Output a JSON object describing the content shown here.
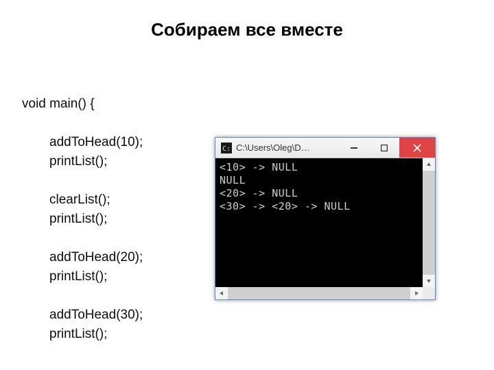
{
  "title": "Собираем все вместе",
  "code": {
    "l0": "void main() {",
    "l1": "addToHead(10);",
    "l2": "printList();",
    "l3": "clearList();",
    "l4": "printList();",
    "l5": "addToHead(20);",
    "l6": "printList();",
    "l7": "addToHead(30);",
    "l8": "printList();"
  },
  "console": {
    "window_title": "C:\\Users\\Oleg\\D…",
    "lines": [
      "<10> -> NULL",
      "NULL",
      "<20> -> NULL",
      "<30> -> <20> -> NULL"
    ]
  }
}
